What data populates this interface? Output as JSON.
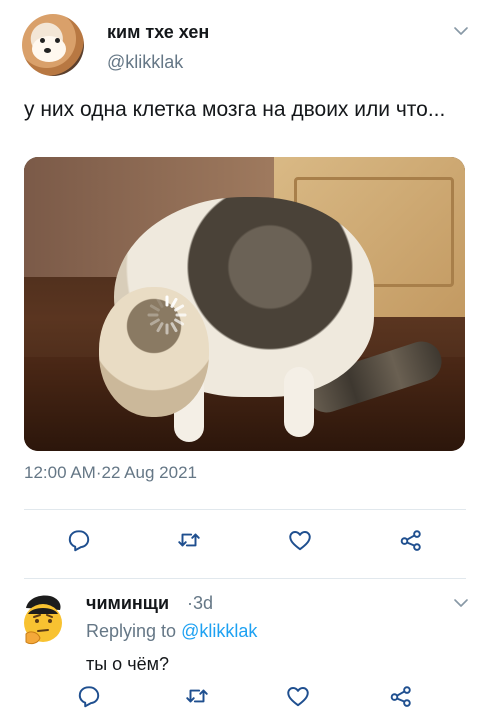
{
  "tweet": {
    "display_name": "ким тхе хен",
    "handle": "@klikklak",
    "text": "у них одна клетка мозга на двоих или что...",
    "timestamp": "12:00 AM·22 Aug 2021"
  },
  "reply": {
    "display_name": "чиминщи",
    "time": "·3d",
    "replying_prefix": "Replying to ",
    "replying_handle": "@klikklak",
    "text": "ты о чём?"
  },
  "icons": {
    "more": "chevron-down-icon",
    "reply": "reply-icon",
    "retweet": "retweet-icon",
    "like": "heart-icon",
    "share": "share-icon",
    "loading": "spinner-icon"
  },
  "colors": {
    "text": "#14171a",
    "secondary": "#657786",
    "link": "#1da1f2",
    "divider": "#e1e8ed"
  }
}
